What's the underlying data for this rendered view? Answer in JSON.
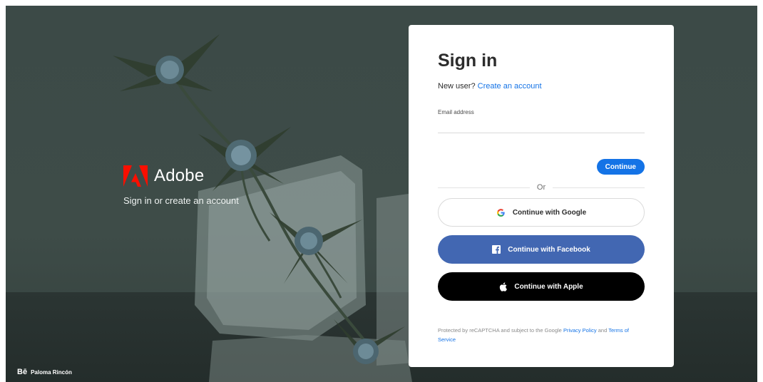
{
  "brand": {
    "name": "Adobe",
    "tagline": "Sign in or create an account",
    "logo_color": "#fa0f00"
  },
  "credit": {
    "icon": "Bē",
    "author": "Paloma Rincón"
  },
  "signin": {
    "title": "Sign in",
    "new_user_text": "New user?",
    "create_account_link": "Create an account",
    "email_label": "Email address",
    "email_value": "",
    "continue_label": "Continue",
    "or_label": "Or",
    "google_label": "Continue with Google",
    "facebook_label": "Continue with Facebook",
    "apple_label": "Continue with Apple",
    "legal_prefix": "Protected by reCAPTCHA and subject to the Google",
    "privacy_link": "Privacy Policy",
    "legal_and": "and",
    "terms_link": "Terms of Service"
  },
  "colors": {
    "accent": "#1473e6",
    "facebook": "#4267b2",
    "apple": "#000000"
  }
}
